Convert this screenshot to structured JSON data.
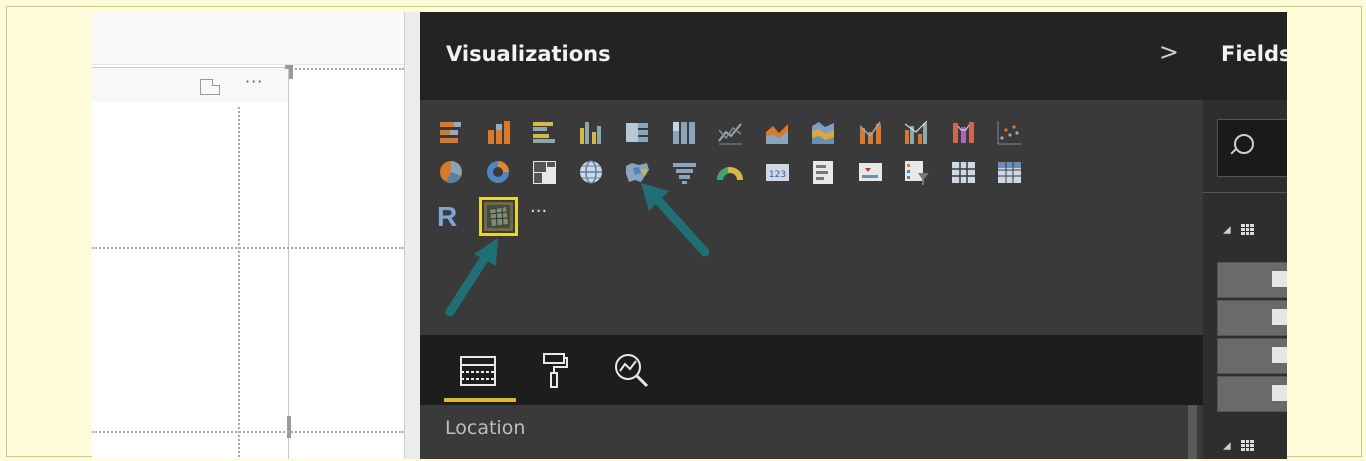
{
  "visualizations_pane": {
    "title": "Visualizations",
    "expand_icon": "chevron-right-icon",
    "icon_rows": [
      [
        "stacked-bar-icon",
        "stacked-column-icon",
        "clustered-bar-icon",
        "clustered-column-icon",
        "100-percent-stacked-bar-icon",
        "100-percent-stacked-column-icon",
        "line-chart-icon",
        "area-chart-icon",
        "stacked-area-chart-icon",
        "line-and-stacked-column-icon",
        "line-and-clustered-column-icon",
        "ribbon-chart-icon",
        "scatter-chart-icon"
      ],
      [
        "pie-chart-icon",
        "donut-chart-icon",
        "treemap-icon",
        "map-icon",
        "filled-map-icon",
        "funnel-icon",
        "gauge-icon",
        "card-icon",
        "multi-row-card-icon",
        "kpi-icon",
        "slicer-icon",
        "table-icon",
        "matrix-icon"
      ],
      [
        "r-script-visual-icon",
        "custom-visual-icon",
        "more-visuals-icon"
      ]
    ],
    "r_label": "R",
    "more_label": "···",
    "selected_icon": "custom-visual-icon",
    "tabs": [
      "fields-tab-icon",
      "format-paint-roller-icon",
      "analytics-magnifier-icon"
    ],
    "active_tab": "fields-tab-icon",
    "well_label": "Location"
  },
  "fields_pane": {
    "title": "Fields",
    "search_icon": "search-icon",
    "tables": [
      "table-icon",
      "table-icon"
    ]
  },
  "canvas": {
    "more_options": "···",
    "focus_mode_icon": "focus-mode-icon"
  },
  "colors": {
    "accent": "#e2b72f",
    "selection": "#e9d43a",
    "pane_bg": "#3a3a3a",
    "header_bg": "#232323",
    "arrow": "#1f6f75",
    "outer_bg": "#fffcd9"
  }
}
